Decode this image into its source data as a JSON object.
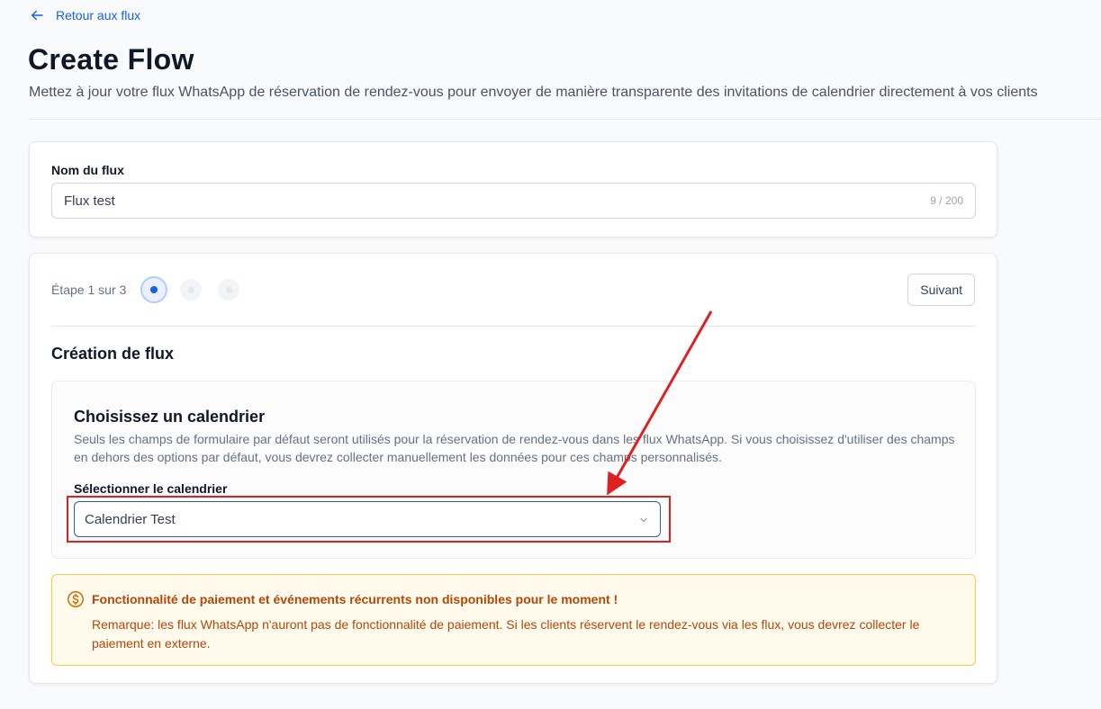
{
  "header": {
    "back_label": "Retour aux flux",
    "title": "Create Flow",
    "subtitle": "Mettez à jour votre flux WhatsApp de réservation de rendez-vous pour envoyer de manière transparente des invitations de calendrier directement à vos clients"
  },
  "flow_name": {
    "label": "Nom du flux",
    "value": "Flux test",
    "char_count": "9 / 200"
  },
  "stepper": {
    "label": "Étape 1 sur 3",
    "current_step": 1,
    "total_steps": 3,
    "next_label": "Suivant"
  },
  "section": {
    "title": "Création de flux"
  },
  "calendar": {
    "title": "Choisissez un calendrier",
    "description": "Seuls les champs de formulaire par défaut seront utilisés pour la réservation de rendez-vous dans les flux WhatsApp. Si vous choisissez d'utiliser des champs en dehors des options par défaut, vous devrez collecter manuellement les données pour ces champs personnalisés.",
    "select_label": "Sélectionner le calendrier",
    "selected_value": "Calendrier Test"
  },
  "warning": {
    "title": "Fonctionnalité de paiement et événements récurrents non disponibles pour le moment !",
    "text": "Remarque: les flux WhatsApp n'auront pas de fonctionnalité de paiement. Si les clients réservent le rendez-vous via les flux, vous devrez collecter le paiement en externe."
  },
  "colors": {
    "accent": "#155eef",
    "warning": "#b54708",
    "annotation": "#e02020"
  },
  "icons": {
    "back": "arrow-left-icon",
    "select": "chevron-down-icon",
    "warning": "dollar-circle-icon"
  }
}
